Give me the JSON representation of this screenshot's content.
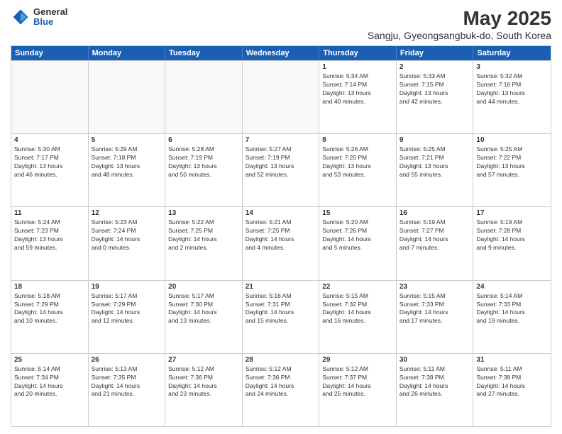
{
  "logo": {
    "general": "General",
    "blue": "Blue"
  },
  "title": "May 2025",
  "subtitle": "Sangju, Gyeongsangbuk-do, South Korea",
  "headers": [
    "Sunday",
    "Monday",
    "Tuesday",
    "Wednesday",
    "Thursday",
    "Friday",
    "Saturday"
  ],
  "weeks": [
    [
      {
        "day": "",
        "info": ""
      },
      {
        "day": "",
        "info": ""
      },
      {
        "day": "",
        "info": ""
      },
      {
        "day": "",
        "info": ""
      },
      {
        "day": "1",
        "info": "Sunrise: 5:34 AM\nSunset: 7:14 PM\nDaylight: 13 hours\nand 40 minutes."
      },
      {
        "day": "2",
        "info": "Sunrise: 5:33 AM\nSunset: 7:15 PM\nDaylight: 13 hours\nand 42 minutes."
      },
      {
        "day": "3",
        "info": "Sunrise: 5:32 AM\nSunset: 7:16 PM\nDaylight: 13 hours\nand 44 minutes."
      }
    ],
    [
      {
        "day": "4",
        "info": "Sunrise: 5:30 AM\nSunset: 7:17 PM\nDaylight: 13 hours\nand 46 minutes."
      },
      {
        "day": "5",
        "info": "Sunrise: 5:29 AM\nSunset: 7:18 PM\nDaylight: 13 hours\nand 48 minutes."
      },
      {
        "day": "6",
        "info": "Sunrise: 5:28 AM\nSunset: 7:19 PM\nDaylight: 13 hours\nand 50 minutes."
      },
      {
        "day": "7",
        "info": "Sunrise: 5:27 AM\nSunset: 7:19 PM\nDaylight: 13 hours\nand 52 minutes."
      },
      {
        "day": "8",
        "info": "Sunrise: 5:26 AM\nSunset: 7:20 PM\nDaylight: 13 hours\nand 53 minutes."
      },
      {
        "day": "9",
        "info": "Sunrise: 5:25 AM\nSunset: 7:21 PM\nDaylight: 13 hours\nand 55 minutes."
      },
      {
        "day": "10",
        "info": "Sunrise: 5:25 AM\nSunset: 7:22 PM\nDaylight: 13 hours\nand 57 minutes."
      }
    ],
    [
      {
        "day": "11",
        "info": "Sunrise: 5:24 AM\nSunset: 7:23 PM\nDaylight: 13 hours\nand 59 minutes."
      },
      {
        "day": "12",
        "info": "Sunrise: 5:23 AM\nSunset: 7:24 PM\nDaylight: 14 hours\nand 0 minutes."
      },
      {
        "day": "13",
        "info": "Sunrise: 5:22 AM\nSunset: 7:25 PM\nDaylight: 14 hours\nand 2 minutes."
      },
      {
        "day": "14",
        "info": "Sunrise: 5:21 AM\nSunset: 7:25 PM\nDaylight: 14 hours\nand 4 minutes."
      },
      {
        "day": "15",
        "info": "Sunrise: 5:20 AM\nSunset: 7:26 PM\nDaylight: 14 hours\nand 5 minutes."
      },
      {
        "day": "16",
        "info": "Sunrise: 5:19 AM\nSunset: 7:27 PM\nDaylight: 14 hours\nand 7 minutes."
      },
      {
        "day": "17",
        "info": "Sunrise: 5:19 AM\nSunset: 7:28 PM\nDaylight: 14 hours\nand 9 minutes."
      }
    ],
    [
      {
        "day": "18",
        "info": "Sunrise: 5:18 AM\nSunset: 7:29 PM\nDaylight: 14 hours\nand 10 minutes."
      },
      {
        "day": "19",
        "info": "Sunrise: 5:17 AM\nSunset: 7:29 PM\nDaylight: 14 hours\nand 12 minutes."
      },
      {
        "day": "20",
        "info": "Sunrise: 5:17 AM\nSunset: 7:30 PM\nDaylight: 14 hours\nand 13 minutes."
      },
      {
        "day": "21",
        "info": "Sunrise: 5:16 AM\nSunset: 7:31 PM\nDaylight: 14 hours\nand 15 minutes."
      },
      {
        "day": "22",
        "info": "Sunrise: 5:15 AM\nSunset: 7:32 PM\nDaylight: 14 hours\nand 16 minutes."
      },
      {
        "day": "23",
        "info": "Sunrise: 5:15 AM\nSunset: 7:33 PM\nDaylight: 14 hours\nand 17 minutes."
      },
      {
        "day": "24",
        "info": "Sunrise: 5:14 AM\nSunset: 7:33 PM\nDaylight: 14 hours\nand 19 minutes."
      }
    ],
    [
      {
        "day": "25",
        "info": "Sunrise: 5:14 AM\nSunset: 7:34 PM\nDaylight: 14 hours\nand 20 minutes."
      },
      {
        "day": "26",
        "info": "Sunrise: 5:13 AM\nSunset: 7:35 PM\nDaylight: 14 hours\nand 21 minutes."
      },
      {
        "day": "27",
        "info": "Sunrise: 5:12 AM\nSunset: 7:36 PM\nDaylight: 14 hours\nand 23 minutes."
      },
      {
        "day": "28",
        "info": "Sunrise: 5:12 AM\nSunset: 7:36 PM\nDaylight: 14 hours\nand 24 minutes."
      },
      {
        "day": "29",
        "info": "Sunrise: 5:12 AM\nSunset: 7:37 PM\nDaylight: 14 hours\nand 25 minutes."
      },
      {
        "day": "30",
        "info": "Sunrise: 5:11 AM\nSunset: 7:38 PM\nDaylight: 14 hours\nand 26 minutes."
      },
      {
        "day": "31",
        "info": "Sunrise: 5:11 AM\nSunset: 7:38 PM\nDaylight: 14 hours\nand 27 minutes."
      }
    ]
  ]
}
